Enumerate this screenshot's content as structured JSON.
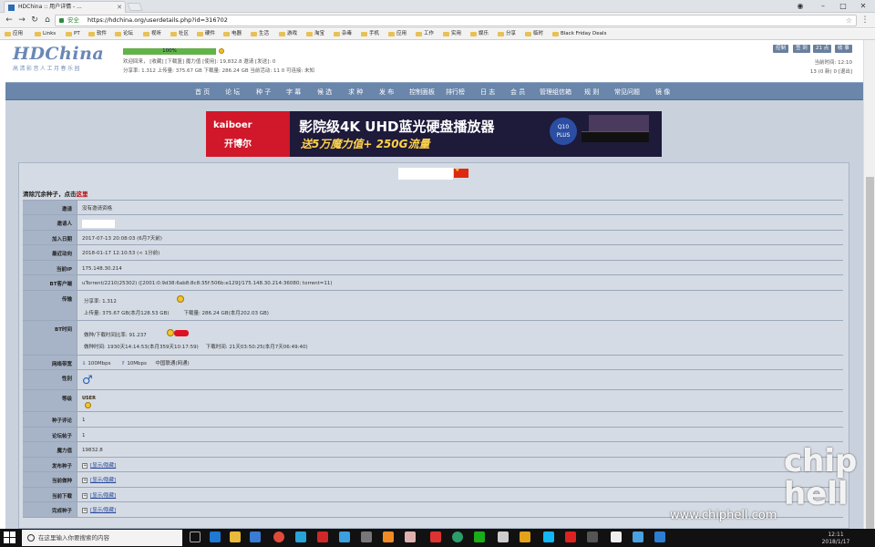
{
  "browser": {
    "tab_title": "HDChina :: 用户详情 - ...",
    "window_controls": [
      "–",
      "□",
      "✕"
    ],
    "profile_icon": "user-icon",
    "nav": [
      "←",
      "→",
      "↻",
      "⌂"
    ],
    "secure_label": "安全",
    "url": "https://hdchina.org/userdetails.php?id=316702",
    "bookmarks": [
      "应用",
      "Links",
      "PT",
      "软件",
      "论坛",
      "视听",
      "社区",
      "硬件",
      "电器",
      "生活",
      "游戏",
      "淘宝",
      "杂毒",
      "手机",
      "应用",
      "工作",
      "实用",
      "娱乐",
      "分享",
      "临时",
      "Black Friday Deals"
    ]
  },
  "header": {
    "logo_title": "HDChina",
    "logo_sub": "高清影音人工月春乐园",
    "progress_label": "100%",
    "progress_value": 100,
    "line1": "欢迎回来，  [收藏]  [下载篮]  魔力值 [使用]: 19,832.8  邀请 [发送]: 0",
    "line2": "分享率: 1.312  上传量: 375.67 GB  下载量: 286.24 GB  当前活动: 11  0  可连接: 未知",
    "right_buttons": [
      "控制",
      "签 到",
      "21 点",
      "收 事"
    ],
    "right_line1": "当前时间: 12:10",
    "right_line2": "13 (0 新)  0  [退出]"
  },
  "menu": [
    "首 页",
    "论 坛",
    "种 子",
    "字 幕",
    "候 选",
    "求 种",
    "发 布",
    "控制面板",
    "排行榜",
    "日 志",
    "会 员",
    "管理组信箱",
    "规 则",
    "常见问题",
    "镜 像"
  ],
  "banner": {
    "brand_en": "kaiboer",
    "brand_cn": "开博尔",
    "headline": "影院级4K UHD蓝光硬盘播放器",
    "subline": "送5万魔力值+ 250G流量",
    "badge1": "Q10",
    "badge2": "PLUS"
  },
  "profile": {
    "clean_prefix": "清除冗余种子，点击",
    "clean_link": "这里",
    "rows": {
      "invite_label": "邀请",
      "invite_value": "没有邀请资格",
      "inviter_label": "邀请人",
      "join_label": "加入日期",
      "join_value": "2017-07-13 20:08:03 (6月7天前)",
      "last_label": "最近动向",
      "last_value": "2018-01-17 12:10:53 (< 1分前)",
      "ip_label": "当前IP",
      "ip_value": "175.148.30.214",
      "bt_label": "BT客户端",
      "bt_value": "uTorrent/2210(25302) ([2001:0:9d38:6ab8:8c8:35f:506b:e129]/175.148.30.214:36080; torrent=11)",
      "traffic_label": "传输",
      "ratio_text": "分享率: 1.312",
      "upload_text": "上传量: 375.67 GB(本月128.53 GB)",
      "download_text": "下载量: 286.24 GB(本月202.03 GB)",
      "bttime_label": "BT时间",
      "seed_ratio_text": "做种/下载时间比率: 91.237",
      "seed_time_text": "做种时间: 1930天14:14:53(本月359天10:17:59)",
      "dl_time_text": "下载时间: 21天03:50:25(本月7天06:49:40)",
      "bandwidth_label": "网络带宽",
      "bw_down": "100Mbps",
      "bw_up": "10Mbps",
      "bw_isp": "中国联通(网通)",
      "gender_label": "性别",
      "gender_symbol": "♂",
      "class_label": "等级",
      "class_value": "USER",
      "comments_label": "种子评论",
      "comments_value": "1",
      "posts_label": "论坛帖子",
      "posts_value": "1",
      "magic_label": "魔力值",
      "magic_value": "19832.8",
      "uploaded_label": "发布种子",
      "seeding_label": "当前做种",
      "leeching_label": "当前下载",
      "completed_label": "完成种子",
      "toggle_text": "[显示/隐藏]"
    }
  },
  "taskbar": {
    "search_placeholder": "在这里输入你要搜索的内容",
    "time": "12:11",
    "date": "2018/1/17"
  },
  "watermark": {
    "site": "www.chiphell.com",
    "logo_line1": "chip",
    "logo_line2": "hell"
  }
}
